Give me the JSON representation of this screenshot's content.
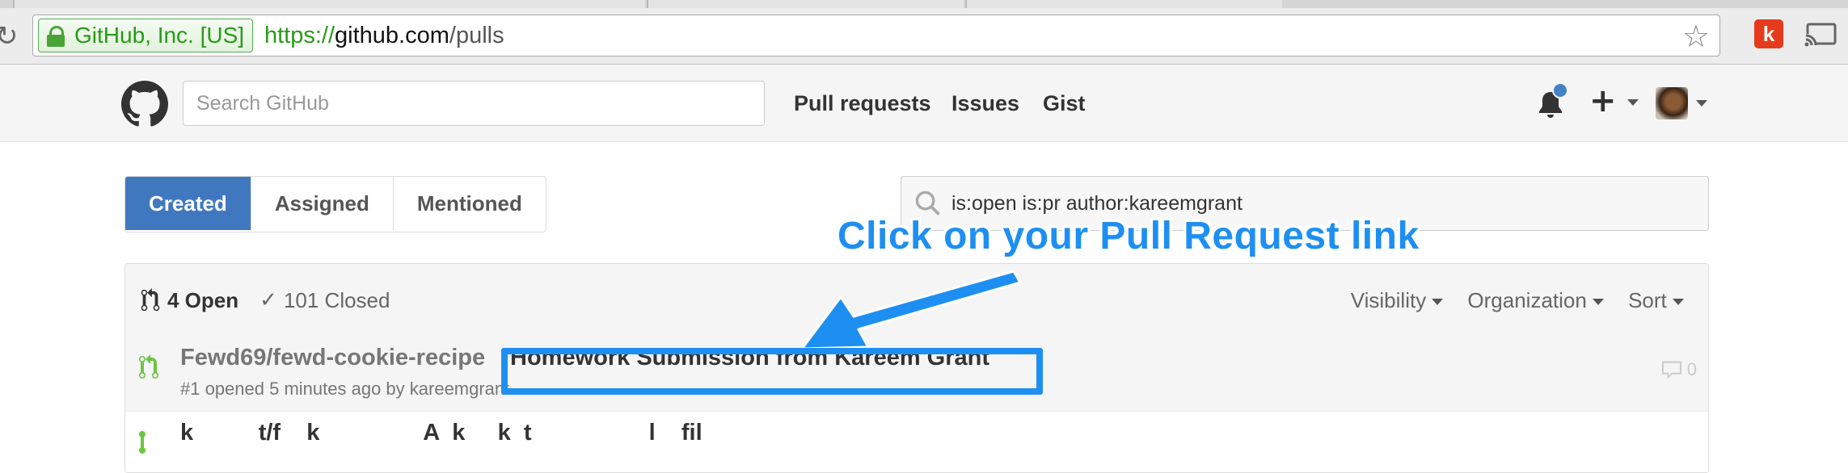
{
  "browser": {
    "ev_label": "GitHub, Inc. [US]",
    "url_scheme": "https://",
    "url_host": "github.com",
    "url_path": "/pulls",
    "extension_label": "k",
    "icons": [
      "reload-icon",
      "lock-icon",
      "star-icon",
      "cast-icon"
    ]
  },
  "header": {
    "search_placeholder": "Search GitHub",
    "nav": [
      "Pull requests",
      "Issues",
      "Gist"
    ],
    "plus": "+",
    "icons": [
      "github-logo-icon",
      "bell-icon",
      "plus-icon",
      "avatar"
    ]
  },
  "subnav": {
    "tabs": [
      "Created",
      "Assigned",
      "Mentioned"
    ],
    "selected": "Created"
  },
  "search": {
    "query": "is:open is:pr author:kareemgrant"
  },
  "list": {
    "open_label": "4 Open",
    "closed_label": "101 Closed",
    "filters": [
      "Visibility",
      "Organization",
      "Sort"
    ],
    "rows": [
      {
        "repo": "Fewd69/fewd-cookie-recipe",
        "title": "Homework Submission from Kareem Grant",
        "meta": "#1 opened 5 minutes ago by kareemgrant",
        "comments": "0"
      },
      {
        "text_partial": "k          t/f    k                A  k     k  t                  l    fil"
      }
    ]
  },
  "annotation": {
    "callout": "Click on your Pull Request link",
    "color": "#1e8ff2"
  },
  "colors": {
    "accent": "#4078c0",
    "ev_green": "#279b18",
    "pr_open_green": "#6cc644"
  }
}
